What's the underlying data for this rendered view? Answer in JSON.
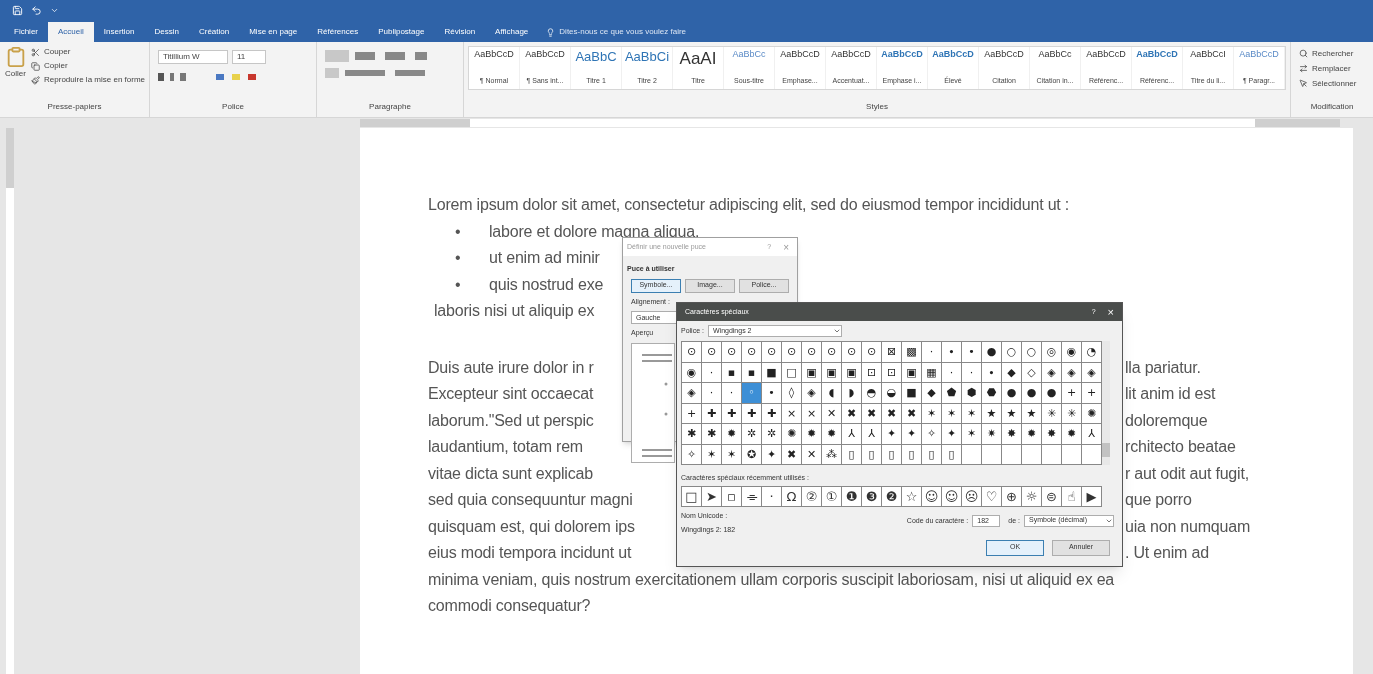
{
  "tabs": [
    {
      "label": "Fichier",
      "selected": false
    },
    {
      "label": "Accueil",
      "selected": true
    },
    {
      "label": "Insertion",
      "selected": false
    },
    {
      "label": "Dessin",
      "selected": false
    },
    {
      "label": "Création",
      "selected": false
    },
    {
      "label": "Mise en page",
      "selected": false
    },
    {
      "label": "Références",
      "selected": false
    },
    {
      "label": "Publipostage",
      "selected": false
    },
    {
      "label": "Révision",
      "selected": false
    },
    {
      "label": "Affichage",
      "selected": false
    }
  ],
  "tell_me": {
    "placeholder": "Dites-nous ce que vous voulez faire"
  },
  "clipboard": {
    "paste": "Coller",
    "cut": "Couper",
    "copy": "Copier",
    "format_painter": "Reproduire la mise en forme",
    "group": "Presse-papiers"
  },
  "font": {
    "name": "Titillium W",
    "size": "11",
    "group": "Police"
  },
  "paragraph": {
    "group": "Paragraphe"
  },
  "styles": {
    "group": "Styles",
    "items": [
      {
        "preview": "AaBbCcD",
        "label": "¶ Normal",
        "kind": "normal"
      },
      {
        "preview": "AaBbCcD",
        "label": "¶ Sans int...",
        "kind": "normal"
      },
      {
        "preview": "AaBbC",
        "label": "Titre 1",
        "kind": "heading"
      },
      {
        "preview": "AaBbCi",
        "label": "Titre 2",
        "kind": "heading"
      },
      {
        "preview": "AaAI",
        "label": "Titre",
        "kind": "title"
      },
      {
        "preview": "AaBbCc",
        "label": "Sous-titre",
        "kind": "subtle"
      },
      {
        "preview": "AaBbCcD",
        "label": "Emphase...",
        "kind": "normal"
      },
      {
        "preview": "AaBbCcD",
        "label": "Accentuat...",
        "kind": "normal"
      },
      {
        "preview": "AaBbCcD",
        "label": "Emphase i...",
        "kind": "strong"
      },
      {
        "preview": "AaBbCcD",
        "label": "Élevé",
        "kind": "strong"
      },
      {
        "preview": "AaBbCcD",
        "label": "Citation",
        "kind": "normal"
      },
      {
        "preview": "AaBbCc",
        "label": "Citation in...",
        "kind": "normal"
      },
      {
        "preview": "AaBbCcD",
        "label": "Référenc...",
        "kind": "normal"
      },
      {
        "preview": "AaBbCcD",
        "label": "Référenc...",
        "kind": "strong"
      },
      {
        "preview": "AaBbCcI",
        "label": "Titre du li...",
        "kind": "normal"
      },
      {
        "preview": "AaBbCcD",
        "label": "¶ Paragr...",
        "kind": "subtle"
      }
    ]
  },
  "editing": {
    "group": "Modification",
    "items": [
      "Rechercher",
      "Remplacer",
      "Sélectionner"
    ]
  },
  "document": {
    "intro": "Lorem ipsum dolor sit amet, consectetur adipiscing elit, sed do eiusmod tempor incididunt ut :",
    "bullets": [
      {
        "marker": "•",
        "text": "labore et dolore magna aliqua."
      },
      {
        "marker": "•",
        "text": "ut enim ad minir"
      },
      {
        "marker": "•",
        "text": "quis nostrud exe"
      }
    ],
    "after_list": "laboris nisi ut aliquip ex",
    "lines": [
      {
        "left": "Duis aute irure dolor in r",
        "right": "lla pariatur."
      },
      {
        "left": "Excepteur sint occaecat",
        "right": "lit anim id est"
      },
      {
        "left": "laborum.\"Sed ut perspic",
        "right": "doloremque"
      },
      {
        "left": "laudantium, totam rem",
        "right": "rchitecto beatae"
      },
      {
        "left": "vitae dicta sunt explicab",
        "right": "r aut odit aut fugit,"
      },
      {
        "left": "sed quia consequuntur magni",
        "right": "que porro"
      },
      {
        "left": "quisquam est, qui dolorem ips",
        "right": "uia non numquam"
      },
      {
        "left": "eius modi tempora incidunt ut",
        "right": ". Ut enim ad"
      }
    ],
    "tail": [
      "minima veniam, quis nostrum exercitationem ullam corporis suscipit laboriosam, nisi ut aliquid ex ea",
      "commodi consequatur?"
    ]
  },
  "bullet_dialog": {
    "title": "Définir une nouvelle puce",
    "help": "?",
    "close": "×",
    "section": "Puce à utiliser",
    "buttons": [
      "Symbole...",
      "Image...",
      "Police..."
    ],
    "alignment_label": "Alignement :",
    "alignment": "Gauche",
    "preview_label": "Aperçu"
  },
  "symbol_dialog": {
    "title": "Caractères spéciaux",
    "help": "?",
    "close": "×",
    "font_label": "Police :",
    "font": "Wingdings 2",
    "rows": [
      [
        {
          "symbol": "⊙",
          "selected": false
        },
        {
          "symbol": "⊙",
          "selected": false
        },
        {
          "symbol": "⊙",
          "selected": false
        },
        {
          "symbol": "⊙",
          "selected": false
        },
        {
          "symbol": "⊙",
          "selected": false
        },
        {
          "symbol": "⊙",
          "selected": false
        },
        {
          "symbol": "⊙",
          "selected": false
        },
        {
          "symbol": "⊙",
          "selected": false
        },
        {
          "symbol": "⊙",
          "selected": false
        },
        {
          "symbol": "⊙",
          "selected": false
        },
        {
          "symbol": "⊠",
          "selected": false
        },
        {
          "symbol": "▩",
          "selected": false
        },
        {
          "symbol": "·",
          "selected": false
        },
        {
          "symbol": "∙",
          "selected": false
        },
        {
          "symbol": "•",
          "selected": false
        },
        {
          "symbol": "●",
          "selected": false
        },
        {
          "symbol": "○",
          "selected": false
        },
        {
          "symbol": "○",
          "selected": false
        },
        {
          "symbol": "◎",
          "selected": false
        },
        {
          "symbol": "◉",
          "selected": false
        },
        {
          "symbol": "◔",
          "selected": false
        }
      ],
      [
        {
          "symbol": "◉",
          "selected": false
        },
        {
          "symbol": "·",
          "selected": false
        },
        {
          "symbol": "▪",
          "selected": false
        },
        {
          "symbol": "▪",
          "selected": false
        },
        {
          "symbol": "■",
          "selected": false
        },
        {
          "symbol": "□",
          "selected": false
        },
        {
          "symbol": "▣",
          "selected": false
        },
        {
          "symbol": "▣",
          "selected": false
        },
        {
          "symbol": "▣",
          "selected": false
        },
        {
          "symbol": "⊡",
          "selected": false
        },
        {
          "symbol": "⊡",
          "selected": false
        },
        {
          "symbol": "▣",
          "selected": false
        },
        {
          "symbol": "▦",
          "selected": false
        },
        {
          "symbol": "·",
          "selected": false
        },
        {
          "symbol": "·",
          "selected": false
        },
        {
          "symbol": "∙",
          "selected": false
        },
        {
          "symbol": "◆",
          "selected": false
        },
        {
          "symbol": "◇",
          "selected": false
        },
        {
          "symbol": "◈",
          "selected": false
        },
        {
          "symbol": "◈",
          "selected": false
        },
        {
          "symbol": "◈",
          "selected": false
        }
      ],
      [
        {
          "symbol": "◈",
          "selected": false
        },
        {
          "symbol": "·",
          "selected": false
        },
        {
          "symbol": "·",
          "selected": false
        },
        {
          "symbol": "◦",
          "selected": true
        },
        {
          "symbol": "•",
          "selected": false
        },
        {
          "symbol": "◊",
          "selected": false
        },
        {
          "symbol": "◈",
          "selected": false
        },
        {
          "symbol": "◖",
          "selected": false
        },
        {
          "symbol": "◗",
          "selected": false
        },
        {
          "symbol": "◓",
          "selected": false
        },
        {
          "symbol": "◒",
          "selected": false
        },
        {
          "symbol": "■",
          "selected": false
        },
        {
          "symbol": "◆",
          "selected": false
        },
        {
          "symbol": "⬟",
          "selected": false
        },
        {
          "symbol": "⬢",
          "selected": false
        },
        {
          "symbol": "⬣",
          "selected": false
        },
        {
          "symbol": "●",
          "selected": false
        },
        {
          "symbol": "●",
          "selected": false
        },
        {
          "symbol": "●",
          "selected": false
        },
        {
          "symbol": "+",
          "selected": false
        },
        {
          "symbol": "+",
          "selected": false
        }
      ],
      [
        {
          "symbol": "+",
          "selected": false
        },
        {
          "symbol": "✚",
          "selected": false
        },
        {
          "symbol": "✚",
          "selected": false
        },
        {
          "symbol": "✚",
          "selected": false
        },
        {
          "symbol": "✚",
          "selected": false
        },
        {
          "symbol": "×",
          "selected": false
        },
        {
          "symbol": "×",
          "selected": false
        },
        {
          "symbol": "✕",
          "selected": false
        },
        {
          "symbol": "✖",
          "selected": false
        },
        {
          "symbol": "✖",
          "selected": false
        },
        {
          "symbol": "✖",
          "selected": false
        },
        {
          "symbol": "✖",
          "selected": false
        },
        {
          "symbol": "✶",
          "selected": false
        },
        {
          "symbol": "✶",
          "selected": false
        },
        {
          "symbol": "✶",
          "selected": false
        },
        {
          "symbol": "★",
          "selected": false
        },
        {
          "symbol": "★",
          "selected": false
        },
        {
          "symbol": "★",
          "selected": false
        },
        {
          "symbol": "✳",
          "selected": false
        },
        {
          "symbol": "✳",
          "selected": false
        },
        {
          "symbol": "✺",
          "selected": false
        }
      ],
      [
        {
          "symbol": "✱",
          "selected": false
        },
        {
          "symbol": "✱",
          "selected": false
        },
        {
          "symbol": "✹",
          "selected": false
        },
        {
          "symbol": "✲",
          "selected": false
        },
        {
          "symbol": "✲",
          "selected": false
        },
        {
          "symbol": "✺",
          "selected": false
        },
        {
          "symbol": "✹",
          "selected": false
        },
        {
          "symbol": "✹",
          "selected": false
        },
        {
          "symbol": "⅄",
          "selected": false
        },
        {
          "symbol": "⅄",
          "selected": false
        },
        {
          "symbol": "✦",
          "selected": false
        },
        {
          "symbol": "✦",
          "selected": false
        },
        {
          "symbol": "✧",
          "selected": false
        },
        {
          "symbol": "✦",
          "selected": false
        },
        {
          "symbol": "✶",
          "selected": false
        },
        {
          "symbol": "✷",
          "selected": false
        },
        {
          "symbol": "✸",
          "selected": false
        },
        {
          "symbol": "✹",
          "selected": false
        },
        {
          "symbol": "✸",
          "selected": false
        },
        {
          "symbol": "✹",
          "selected": false
        },
        {
          "symbol": "⅄",
          "selected": false
        }
      ],
      [
        {
          "symbol": "✧",
          "selected": false
        },
        {
          "symbol": "✶",
          "selected": false
        },
        {
          "symbol": "✶",
          "selected": false
        },
        {
          "symbol": "✪",
          "selected": false
        },
        {
          "symbol": "✦",
          "selected": false
        },
        {
          "symbol": "✖",
          "selected": false
        },
        {
          "symbol": "✕",
          "selected": false
        },
        {
          "symbol": "⁂",
          "selected": false
        },
        {
          "symbol": "▯",
          "selected": false
        },
        {
          "symbol": "▯",
          "selected": false
        },
        {
          "symbol": "▯",
          "selected": false
        },
        {
          "symbol": "▯",
          "selected": false
        },
        {
          "symbol": "▯",
          "selected": false
        },
        {
          "symbol": "▯",
          "selected": false
        }
      ]
    ],
    "recent_label": "Caractères spéciaux récemment utilisés :",
    "recent": [
      "□",
      "➤",
      "▫",
      "⌯",
      "·",
      "Ω",
      "②",
      "①",
      "❶",
      "❸",
      "❷",
      "☆",
      "☺",
      "☺",
      "☹",
      "♡",
      "⊕",
      "☼",
      "⊜",
      "☝",
      "▶"
    ],
    "unicode_label": "Nom Unicode :",
    "char_name": "Wingdings 2: 182",
    "code_label": "Code du caractère :",
    "code": "182",
    "from_label": "de :",
    "from": "Symbole (décimal)",
    "ok": "OK",
    "cancel": "Annuler"
  }
}
